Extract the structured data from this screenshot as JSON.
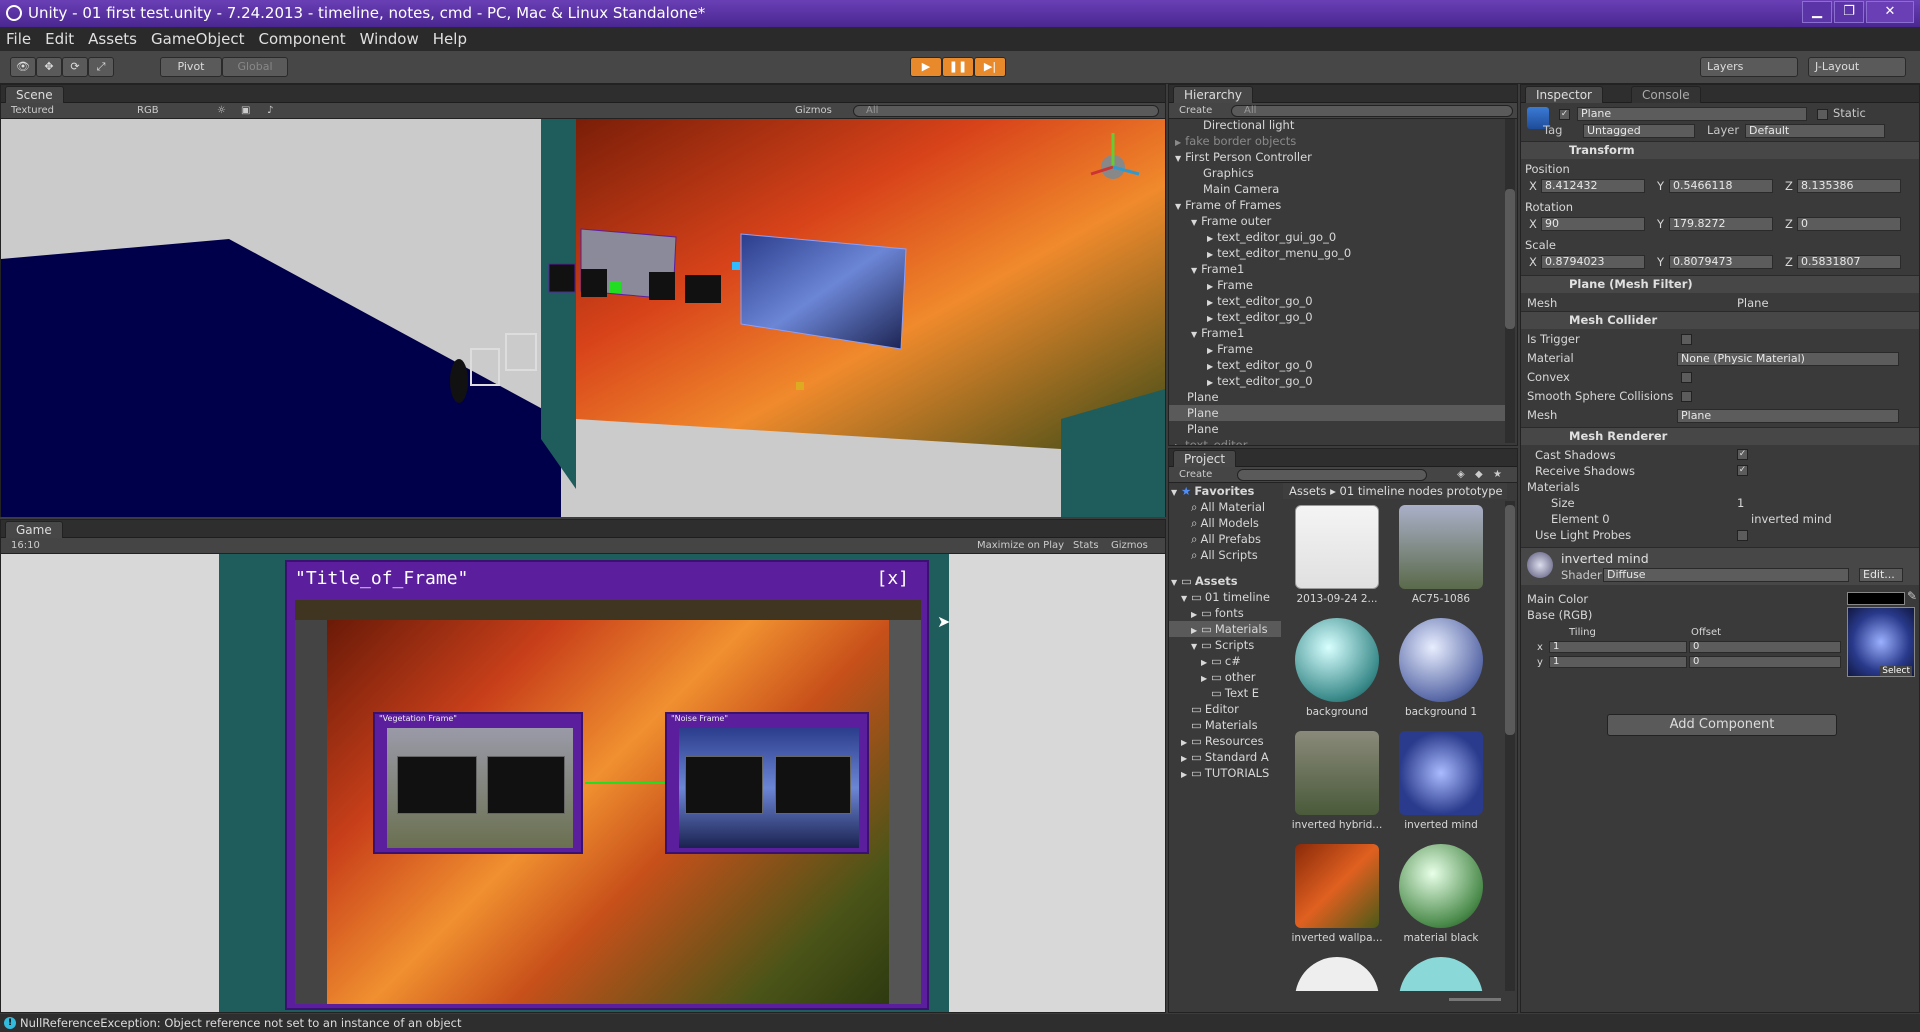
{
  "window": {
    "title": "Unity - 01 first test.unity - 7.24.2013 - timeline, notes, cmd - PC, Mac & Linux Standalone*"
  },
  "menu": [
    "File",
    "Edit",
    "Assets",
    "GameObject",
    "Component",
    "Window",
    "Help"
  ],
  "toolbar": {
    "pivot": "Pivot",
    "global": "Global",
    "layers": "Layers",
    "layout": "J-Layout"
  },
  "scene": {
    "tab": "Scene",
    "render_mode": "Textured",
    "color_mode": "RGB",
    "gizmos": "Gizmos",
    "search_placeholder": "All"
  },
  "game": {
    "tab": "Game",
    "aspect": "16:10",
    "maximize": "Maximize on Play",
    "stats": "Stats",
    "gizmos": "Gizmos",
    "frame_title": "\"Title_of_Frame\"",
    "frame_close": "[x]",
    "small_frame_1": "\"Vegetation Frame\"",
    "small_frame_2": "\"Noise Frame\""
  },
  "hierarchy": {
    "tab": "Hierarchy",
    "create": "Create",
    "search_placeholder": "All",
    "items": [
      {
        "label": "Directional light",
        "indent": 1
      },
      {
        "label": "fake border objects",
        "indent": 0,
        "arrow": "▶",
        "grey": true
      },
      {
        "label": "First Person Controller",
        "indent": 0,
        "arrow": "▼"
      },
      {
        "label": "Graphics",
        "indent": 1
      },
      {
        "label": "Main Camera",
        "indent": 1
      },
      {
        "label": "Frame of Frames",
        "indent": 0,
        "arrow": "▼"
      },
      {
        "label": "Frame outer",
        "indent": 1,
        "arrow": "▼"
      },
      {
        "label": "text_editor_gui_go_0",
        "indent": 2,
        "arrow": "▶"
      },
      {
        "label": "text_editor_menu_go_0",
        "indent": 2,
        "arrow": "▶"
      },
      {
        "label": "Frame1",
        "indent": 1,
        "arrow": "▼"
      },
      {
        "label": "Frame",
        "indent": 2,
        "arrow": "▶"
      },
      {
        "label": "text_editor_go_0",
        "indent": 2,
        "arrow": "▶"
      },
      {
        "label": "text_editor_go_0",
        "indent": 2,
        "arrow": "▶"
      },
      {
        "label": "Frame1",
        "indent": 1,
        "arrow": "▼"
      },
      {
        "label": "Frame",
        "indent": 2,
        "arrow": "▶"
      },
      {
        "label": "text_editor_go_0",
        "indent": 2,
        "arrow": "▶"
      },
      {
        "label": "text_editor_go_0",
        "indent": 2,
        "arrow": "▶"
      },
      {
        "label": "Plane",
        "indent": 0
      },
      {
        "label": "Plane",
        "indent": 0,
        "selected": true
      },
      {
        "label": "Plane",
        "indent": 0
      },
      {
        "label": "text_editor",
        "indent": 0,
        "arrow": "▶",
        "grey": true
      }
    ]
  },
  "project": {
    "tab": "Project",
    "create": "Create",
    "breadcrumb": [
      "Assets",
      "01 timeline nodes prototype"
    ],
    "favorites": {
      "label": "Favorites",
      "items": [
        "All Material",
        "All Models",
        "All Prefabs",
        "All Scripts"
      ]
    },
    "assets": {
      "label": "Assets",
      "items": [
        {
          "label": "01 timeline",
          "indent": 1,
          "arrow": "▼"
        },
        {
          "label": "fonts",
          "indent": 2,
          "arrow": "▶"
        },
        {
          "label": "Materials",
          "indent": 2,
          "arrow": "▶",
          "selected": true
        },
        {
          "label": "Scripts",
          "indent": 2,
          "arrow": "▼"
        },
        {
          "label": "c#",
          "indent": 3,
          "arrow": "▶"
        },
        {
          "label": "other",
          "indent": 3,
          "arrow": "▶"
        },
        {
          "label": "Text E",
          "indent": 3
        },
        {
          "label": "Editor",
          "indent": 1
        },
        {
          "label": "Materials",
          "indent": 1
        },
        {
          "label": "Resources",
          "indent": 1,
          "arrow": "▶"
        },
        {
          "label": "Standard A",
          "indent": 1,
          "arrow": "▶"
        },
        {
          "label": "TUTORIALS",
          "indent": 1,
          "arrow": "▶"
        }
      ]
    },
    "grid": [
      {
        "label": "2013-09-24 2...",
        "kind": "screenshot"
      },
      {
        "label": "AC75-1086",
        "kind": "photo"
      },
      {
        "label": "background",
        "kind": "sphere-teal"
      },
      {
        "label": "background 1",
        "kind": "sphere-blue"
      },
      {
        "label": "inverted hybrid...",
        "kind": "photo-green"
      },
      {
        "label": "inverted mind",
        "kind": "photo-blue"
      },
      {
        "label": "inverted wallpa...",
        "kind": "photo-autumn"
      },
      {
        "label": "material black",
        "kind": "sphere-green"
      }
    ]
  },
  "inspector": {
    "tab": "Inspector",
    "console_tab": "Console",
    "object_name": "Plane",
    "static": "Static",
    "tag_label": "Tag",
    "tag": "Untagged",
    "layer_label": "Layer",
    "layer": "Default",
    "transform": {
      "title": "Transform",
      "position": {
        "label": "Position",
        "x": "8.412432",
        "y": "0.5466118",
        "z": "8.135386"
      },
      "rotation": {
        "label": "Rotation",
        "x": "90",
        "y": "179.8272",
        "z": "0"
      },
      "scale": {
        "label": "Scale",
        "x": "0.8794023",
        "y": "0.8079473",
        "z": "0.5831807"
      }
    },
    "mesh_filter": {
      "title": "Plane (Mesh Filter)",
      "mesh_label": "Mesh",
      "mesh": "Plane"
    },
    "mesh_collider": {
      "title": "Mesh Collider",
      "is_trigger": "Is Trigger",
      "material_label": "Material",
      "material": "None (Physic Material)",
      "convex": "Convex",
      "smooth": "Smooth Sphere Collisions",
      "mesh_label": "Mesh",
      "mesh": "Plane"
    },
    "mesh_renderer": {
      "title": "Mesh Renderer",
      "cast": "Cast Shadows",
      "receive": "Receive Shadows",
      "materials": "Materials",
      "size_label": "Size",
      "size": "1",
      "element_label": "Element 0",
      "element": "inverted mind",
      "light_probes": "Use Light Probes"
    },
    "material": {
      "name": "inverted mind",
      "shader_label": "Shader",
      "shader": "Diffuse",
      "edit": "Edit...",
      "main_color": "Main Color",
      "base": "Base (RGB)",
      "tiling": "Tiling",
      "offset": "Offset",
      "tx": "1",
      "ty": "1",
      "ox": "0",
      "oy": "0",
      "select": "Select"
    },
    "add_component": "Add Component"
  },
  "status": {
    "message": "NullReferenceException: Object reference not set to an instance of an object"
  },
  "colors": {
    "title_bar": "#5a32a3",
    "accent_selected": "#5a5a5a",
    "frame_border": "#5b1f9e",
    "teal": "#1f5c5c"
  }
}
